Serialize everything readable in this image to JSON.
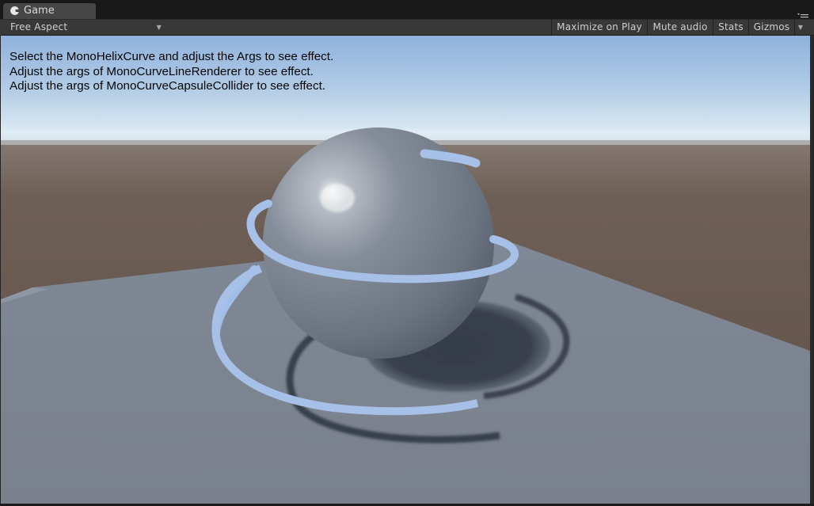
{
  "tab": {
    "title": "Game",
    "icon": "game-controller-icon"
  },
  "toolbar": {
    "aspect": "Free Aspect",
    "maximize_on_play": "Maximize on Play",
    "mute_audio": "Mute audio",
    "stats": "Stats",
    "gizmos": "Gizmos"
  },
  "overlay": {
    "lines": [
      "Select the MonoHelixCurve and adjust the Args to see effect.",
      "Adjust the args of MonoCurveLineRenderer to see effect.",
      "Adjust the args of MonoCurveCapsuleCollider to see effect."
    ]
  },
  "colors": {
    "sky": "#9cbbe0",
    "horizon": "#d8e8f2",
    "ground": "#6e5d54",
    "plane": "#7a8594",
    "sphere": "#7c8592",
    "helix": "#a8c2ea",
    "shadow": "#353c48"
  }
}
